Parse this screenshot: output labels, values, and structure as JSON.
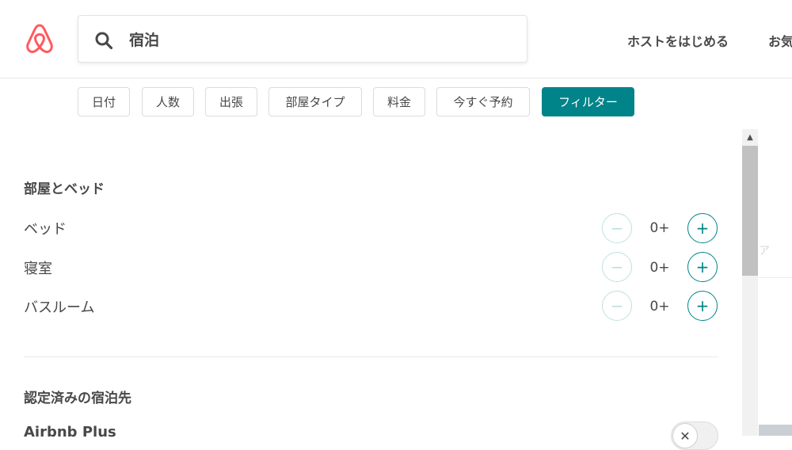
{
  "header": {
    "search_text": "宿泊",
    "nav": {
      "host": "ホストをはじめる",
      "favorites": "お気"
    }
  },
  "filters": [
    {
      "label": "日付"
    },
    {
      "label": "人数"
    },
    {
      "label": "出張"
    },
    {
      "label": "部屋タイプ"
    },
    {
      "label": "料金"
    },
    {
      "label": "今すぐ予約"
    },
    {
      "label": "フィルター",
      "active": true
    }
  ],
  "rooms_section": {
    "title": "部屋とベッド",
    "rows": [
      {
        "label": "ベッド",
        "value": "0+",
        "minus": "−",
        "plus": "+"
      },
      {
        "label": "寝室",
        "value": "0+",
        "minus": "−",
        "plus": "+"
      },
      {
        "label": "バスルーム",
        "value": "0+",
        "minus": "−",
        "plus": "+"
      }
    ]
  },
  "verified_section": {
    "title": "認定済みの宿泊先",
    "plus_label": "Airbnb Plus",
    "toggle_symbol": "✕"
  },
  "background_peek": {
    "text": "ア"
  },
  "colors": {
    "brand": "#FF5A5F",
    "accent": "#008489",
    "text": "#484848"
  }
}
